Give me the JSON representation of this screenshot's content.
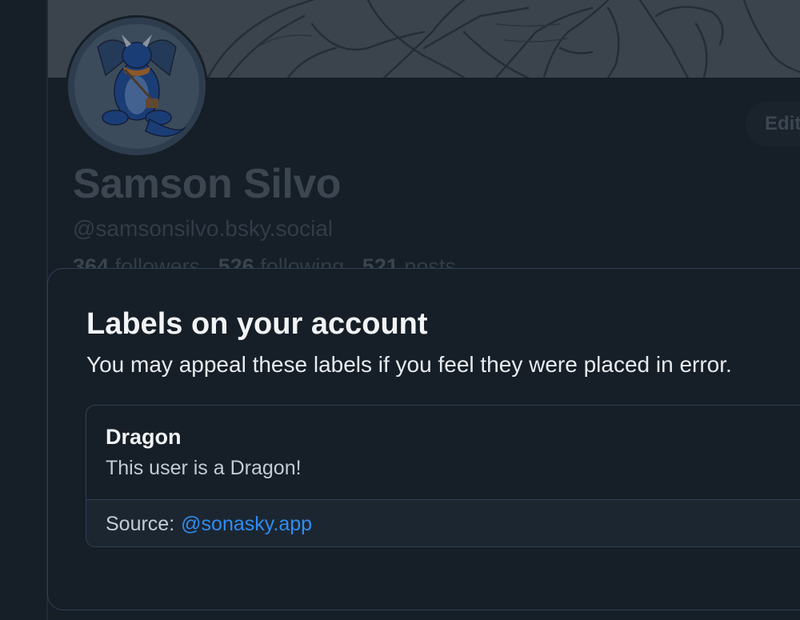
{
  "profile": {
    "name": "Samson Silvo",
    "handle": "@samsonsilvo.bsky.social",
    "followers_count": "364",
    "followers_label": "followers",
    "following_count": "526",
    "following_label": "following",
    "posts_count": "521",
    "posts_label": "posts",
    "edit_label": "Edit"
  },
  "modal": {
    "title": "Labels on your account",
    "subtitle": "You may appeal these labels if you feel they were placed in error.",
    "labels": [
      {
        "name": "Dragon",
        "description": "This user is a Dragon!",
        "source_prefix": "Source:",
        "source_handle": "@sonasky.app"
      }
    ]
  },
  "colors": {
    "background": "#161e27",
    "border": "#2e4158",
    "link": "#2f8cf2",
    "source_bg": "#1c2631"
  }
}
